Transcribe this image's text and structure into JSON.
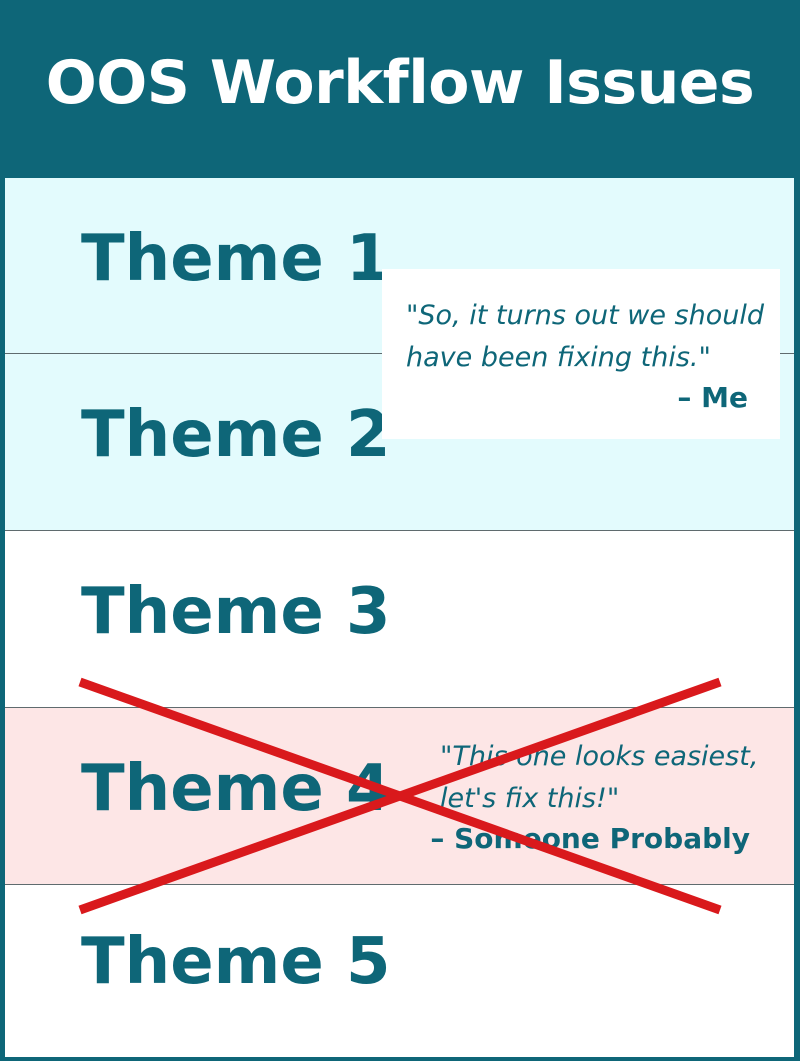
{
  "title": "OOS Workflow Issues",
  "themes": [
    {
      "label": "Theme 1",
      "highlight": "#e3fbfd"
    },
    {
      "label": "Theme 2",
      "highlight": "#e3fbfd"
    },
    {
      "label": "Theme 3",
      "highlight": "#ffffff"
    },
    {
      "label": "Theme 4",
      "highlight": "#fde6e6",
      "crossed_out": true
    },
    {
      "label": "Theme 5",
      "highlight": "#ffffff"
    }
  ],
  "quotes": [
    {
      "line1": "\"So, it turns out we should",
      "line2": "have been fixing this.\"",
      "attribution": "– Me"
    },
    {
      "line1": "\"This one looks easiest,",
      "line2": "let's fix this!\"",
      "attribution": "– Someone Probably"
    }
  ],
  "colors": {
    "primary": "#0e6678",
    "cross": "#d9191c"
  }
}
